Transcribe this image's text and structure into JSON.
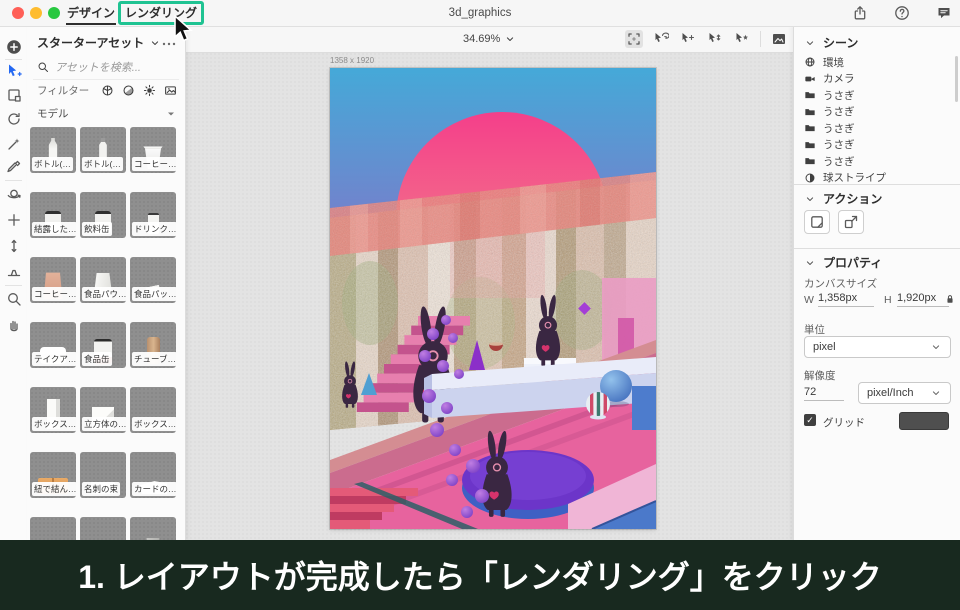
{
  "topbar": {
    "title": "3d_graphics",
    "tabs": [
      {
        "label": "デザイン",
        "active": true
      },
      {
        "label": "レンダリング",
        "active": false,
        "highlighted": true
      }
    ],
    "icons": [
      "share-icon",
      "help-icon",
      "feedback-icon"
    ],
    "highlight_color": "#1fc392"
  },
  "toolbar": {
    "icons": [
      "add-icon",
      "select-move-icon",
      "marquee-icon",
      "rotate-icon",
      "magic-wand-icon",
      "sampler-icon",
      "orbit-icon",
      "pan-cross-icon",
      "dolly-icon",
      "horizon-icon",
      "zoom-icon",
      "hand-icon"
    ]
  },
  "assets": {
    "header": "スターターアセット",
    "menu_icon": "more-icon",
    "search_placeholder": "アセットを検索...",
    "filter_label": "フィルター",
    "filter_icons": [
      "filter-model-icon",
      "filter-material-icon",
      "filter-light-icon",
      "filter-image-icon"
    ],
    "section_label": "モデル",
    "items": [
      {
        "label": "ボトル(…",
        "shape": "bottle"
      },
      {
        "label": "ボトル(…",
        "shape": "bottle2"
      },
      {
        "label": "コーヒー…",
        "shape": "cup"
      },
      {
        "label": "結露した…",
        "shape": "can"
      },
      {
        "label": "飲料缶",
        "shape": "can"
      },
      {
        "label": "ドリンク…",
        "shape": "drinkbox"
      },
      {
        "label": "コーヒー…",
        "shape": "coffeebag"
      },
      {
        "label": "食品パウ…",
        "shape": "pouch"
      },
      {
        "label": "食品パッ…",
        "shape": "packet"
      },
      {
        "label": "テイクア…",
        "shape": "clamshell"
      },
      {
        "label": "食品缶",
        "shape": "foodcan"
      },
      {
        "label": "チューブ…",
        "shape": "tube"
      },
      {
        "label": "ボックス…",
        "shape": "tallbox"
      },
      {
        "label": "立方体の…",
        "shape": "cube"
      },
      {
        "label": "ボックス…",
        "shape": "wedge"
      },
      {
        "label": "紐で結ん…",
        "shape": "tiedbox"
      },
      {
        "label": "名刺の束",
        "shape": "cardstack"
      },
      {
        "label": "カードの…",
        "shape": "cards"
      },
      {
        "label": "",
        "shape": "paper"
      },
      {
        "label": "",
        "shape": "mat"
      },
      {
        "label": "",
        "shape": "bin"
      }
    ]
  },
  "viewport": {
    "zoom_label": "34.69%",
    "size_label": "1358 x 1920",
    "tools": [
      "select-region-icon",
      "orbit-cursor-icon",
      "pan-cursor-icon",
      "dolly-cursor-icon",
      "star-cursor-icon",
      "match-image-icon"
    ]
  },
  "scene": {
    "header": "シーン",
    "items": [
      {
        "icon": "globe-icon",
        "label": "環境"
      },
      {
        "icon": "camera-icon",
        "label": "カメラ"
      },
      {
        "icon": "folder-icon",
        "label": "うさぎ"
      },
      {
        "icon": "folder-icon",
        "label": "うさぎ"
      },
      {
        "icon": "folder-icon",
        "label": "うさぎ"
      },
      {
        "icon": "folder-icon",
        "label": "うさぎ"
      },
      {
        "icon": "folder-icon",
        "label": "うさぎ"
      },
      {
        "icon": "sphere-icon",
        "label": "球ストライプ"
      }
    ]
  },
  "actions": {
    "header": "アクション",
    "buttons": [
      "doc-action-icon",
      "share-action-icon"
    ]
  },
  "properties": {
    "header": "プロパティ",
    "canvas_size_label": "カンバスサイズ",
    "w_label": "W",
    "w_value": "1,358px",
    "h_label": "H",
    "h_value": "1,920px",
    "unit_label": "単位",
    "unit_value": "pixel",
    "resolution_label": "解像度",
    "resolution_value": "72",
    "resolution_unit": "pixel/Inch",
    "grid_label": "グリッド",
    "grid_checked": true
  },
  "banner": {
    "text": "1. レイアウトが完成したら「レンダリング」をクリック",
    "background": "#18291f"
  }
}
